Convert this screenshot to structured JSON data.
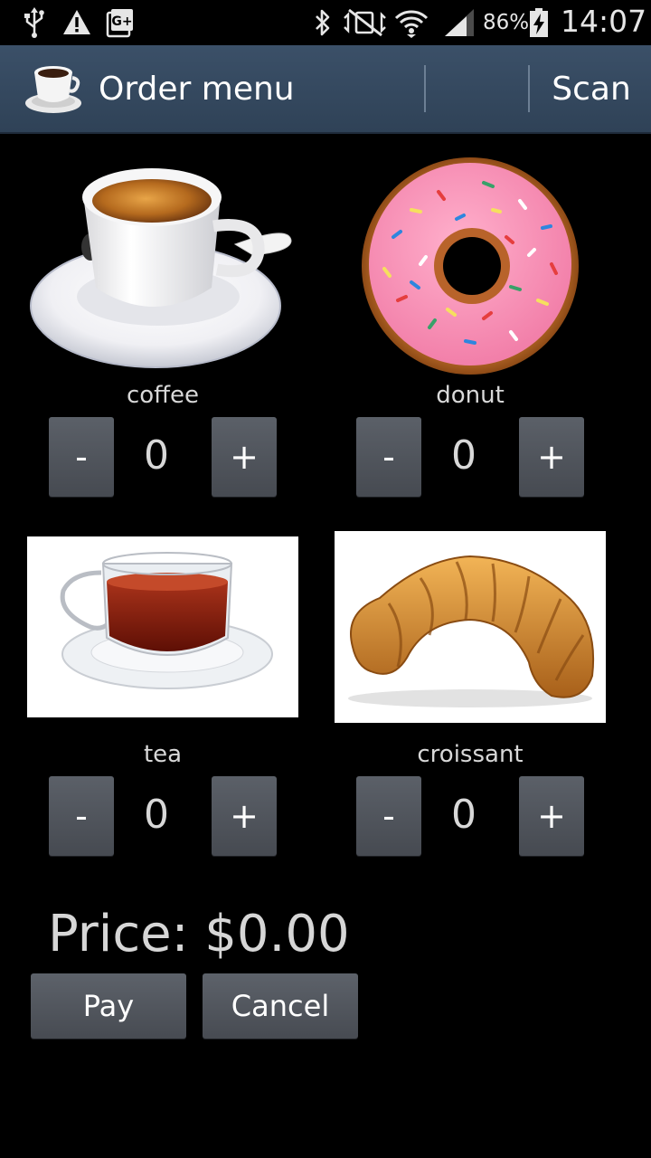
{
  "status_bar": {
    "icons": [
      "usb-icon",
      "warning-icon",
      "google-plus-notification-icon",
      "bluetooth-icon",
      "mute-icon",
      "wifi-icon",
      "signal-icon",
      "battery-charging-icon"
    ],
    "battery_percent": "86%",
    "time": "14:07"
  },
  "action_bar": {
    "title": "Order menu",
    "scan_label": "Scan",
    "colors": {
      "background": "#34495e",
      "divider": "#6c7f94"
    }
  },
  "menu": {
    "items": [
      {
        "name": "coffee",
        "quantity": "0",
        "minus": "-",
        "plus": "+"
      },
      {
        "name": "donut",
        "quantity": "0",
        "minus": "-",
        "plus": "+"
      },
      {
        "name": "tea",
        "quantity": "0",
        "minus": "-",
        "plus": "+"
      },
      {
        "name": "croissant",
        "quantity": "0",
        "minus": "-",
        "plus": "+"
      }
    ]
  },
  "order": {
    "price_label": "Price: $0.00",
    "pay_label": "Pay",
    "cancel_label": "Cancel"
  }
}
